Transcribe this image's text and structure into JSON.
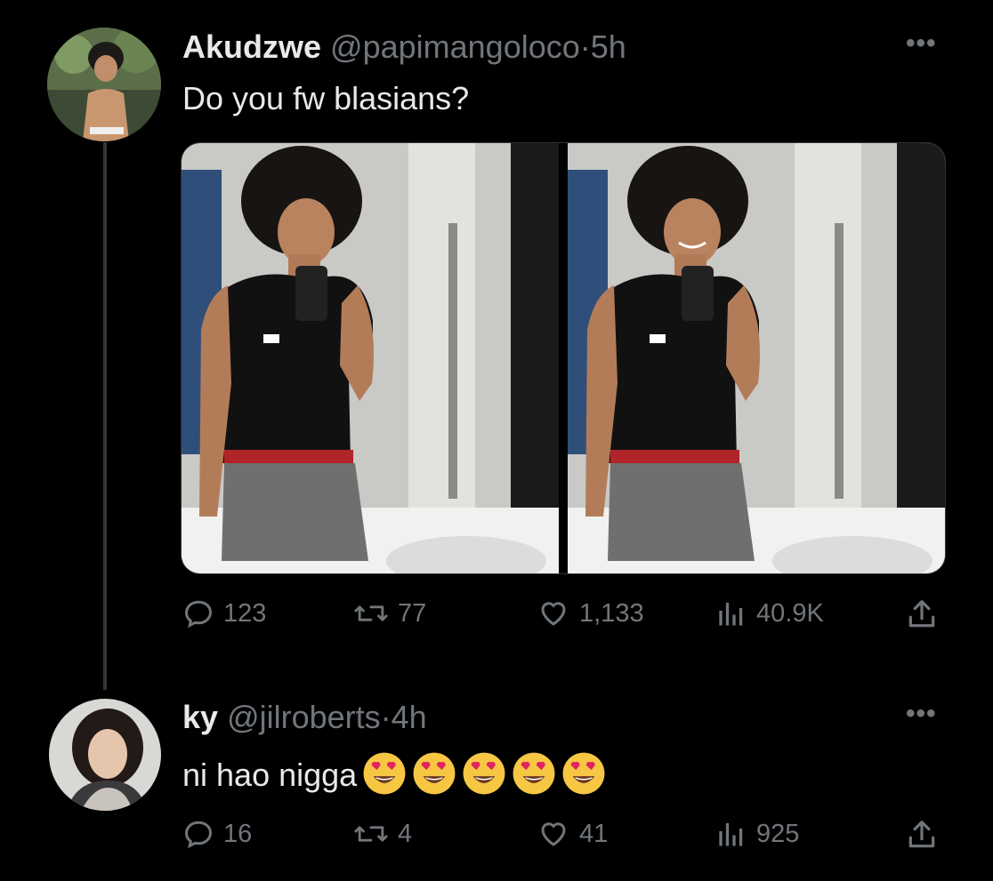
{
  "tweet": {
    "author_name": "Akudzwe",
    "author_handle": "@papimangoloco",
    "separator": "·",
    "time": "5h",
    "text": "Do you fw blasians?",
    "stats": {
      "replies": "123",
      "retweets": "77",
      "likes": "1,133",
      "views": "40.9K"
    },
    "more_icon": "ellipsis-icon"
  },
  "reply": {
    "author_name": "ky",
    "author_handle": "@jilroberts",
    "separator": "·",
    "time": "4h",
    "text": "ni hao nigga",
    "emoji": "smiling-face-with-heart-eyes",
    "emoji_count": 5,
    "stats": {
      "replies": "16",
      "retweets": "4",
      "likes": "41",
      "views": "925"
    }
  },
  "colors": {
    "background": "#000000",
    "primary_text": "#e7e9ea",
    "secondary_text": "#71767b",
    "thread_line": "#333639"
  },
  "icons": [
    "reply-icon",
    "retweet-icon",
    "like-icon",
    "views-icon",
    "share-icon",
    "ellipsis-icon"
  ]
}
